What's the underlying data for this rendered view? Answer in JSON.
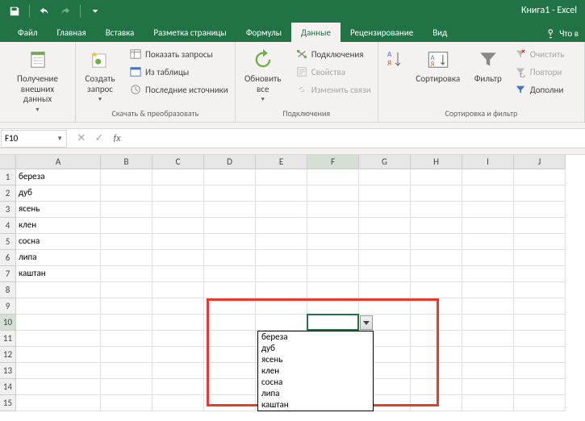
{
  "app": {
    "title": "Книга1 - Excel"
  },
  "tabs": {
    "file": "Файл",
    "home": "Главная",
    "insert": "Вставка",
    "page_layout": "Разметка страницы",
    "formulas": "Формулы",
    "data": "Данные",
    "review": "Рецензирование",
    "view": "Вид",
    "tell_me": "Что в"
  },
  "ribbon": {
    "get_data": {
      "label": "Получение\nвнешних данных"
    },
    "new_query": {
      "label": "Создать\nзапрос"
    },
    "show_queries": "Показать запросы",
    "from_table": "Из таблицы",
    "recent_sources": "Последние источники",
    "group1": "Скачать & преобразовать",
    "refresh_all": {
      "label": "Обновить\nвсе"
    },
    "connections": "Подключения",
    "properties": "Свойства",
    "edit_links": "Изменить связи",
    "group2": "Подключения",
    "sort": "Сортировка",
    "filter": "Фильтр",
    "clear": "Очистить",
    "reapply": "Повтори",
    "advanced": "Дополни",
    "group3": "Сортировка и фильтр"
  },
  "name_box": "F10",
  "columns": [
    "A",
    "B",
    "C",
    "D",
    "E",
    "F",
    "G",
    "H",
    "I",
    "J"
  ],
  "rows": [
    "1",
    "2",
    "3",
    "4",
    "5",
    "6",
    "7",
    "8",
    "9",
    "10",
    "11",
    "12",
    "13",
    "14",
    "15"
  ],
  "cells": {
    "A1": "береза",
    "A2": "дуб",
    "A3": "ясень",
    "A4": "клен",
    "A5": "сосна",
    "A6": "липа",
    "A7": "каштан"
  },
  "dropdown": {
    "items": [
      "береза",
      "дуб",
      "ясень",
      "клен",
      "сосна",
      "липа",
      "каштан"
    ]
  },
  "chart_data": {
    "type": "table",
    "source_range": "A1:A7",
    "values": [
      "береза",
      "дуб",
      "ясень",
      "клен",
      "сосна",
      "липа",
      "каштан"
    ],
    "dropdown_cell": "F10"
  }
}
